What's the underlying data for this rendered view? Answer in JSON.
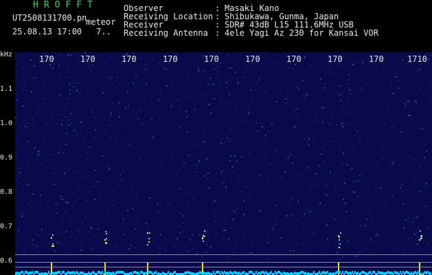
{
  "header": {
    "brand": "HROFFT",
    "filename": "UT2508131700.pn",
    "mode": "meteor",
    "datetime": "25.08.13 17:00",
    "page": "7..",
    "rows": [
      {
        "label": "Observer",
        "value": "Masaki Kano"
      },
      {
        "label": "Receiving Location",
        "value": "Shibukawa, Gunma, Japan"
      },
      {
        "label": "Receiver",
        "value": "SDR# 43dB L15 111.6MHz USB"
      },
      {
        "label": "Receiving Antenna",
        "value": "4ele Yagi Az 230 for Kansai VOR"
      }
    ],
    "sep": ":"
  },
  "axis": {
    "unit": "kHz",
    "y_ticks": [
      "1.1",
      "1.0",
      "0.9",
      "0.8",
      "0.7",
      "0.6"
    ],
    "x_ticks": [
      "170",
      "170",
      "170",
      "170",
      "170",
      "170",
      "170",
      "170",
      "170",
      "1710"
    ]
  },
  "colors": {
    "background": "#0a0a4a",
    "signal": "#00ccff",
    "burst": "#ffee00"
  }
}
